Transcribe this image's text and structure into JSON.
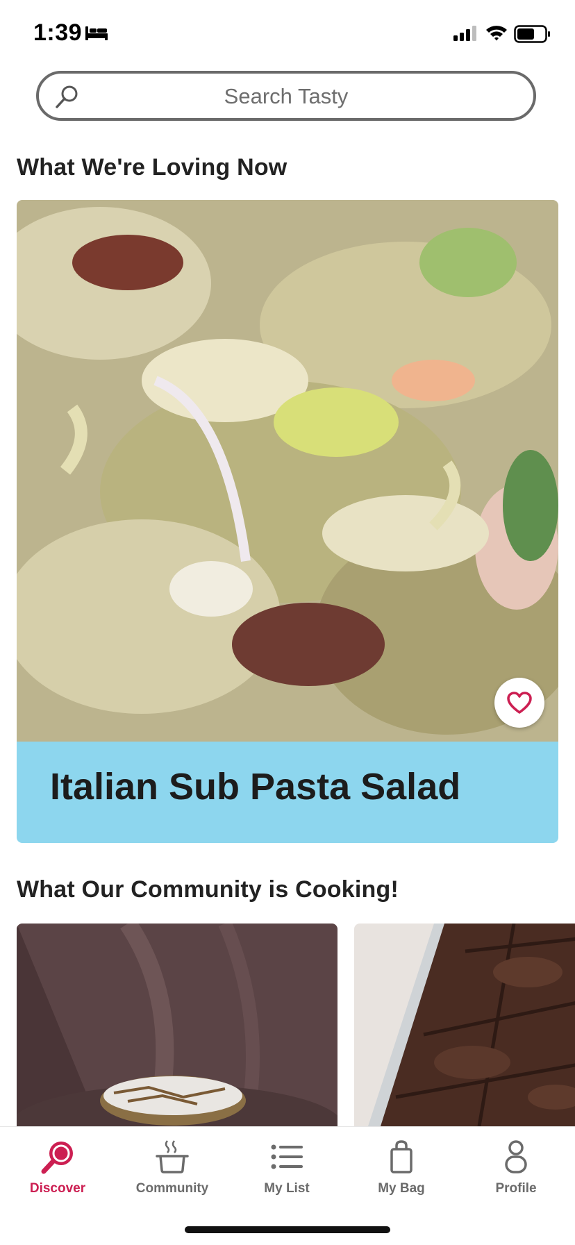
{
  "status_bar": {
    "time": "1:39",
    "icons": [
      "bed-icon",
      "signal-icon",
      "wifi-icon",
      "battery-icon"
    ]
  },
  "search": {
    "placeholder": "Search Tasty",
    "icon": "search-icon"
  },
  "sections": {
    "featured_title": "What We're Loving Now",
    "community_title": "What Our Community is Cooking!"
  },
  "featured": {
    "title": "Italian Sub Pasta Salad",
    "banner_color": "#8dd6ee",
    "favorite_icon": "heart-icon",
    "favorite_color": "#cc1f52"
  },
  "community": {
    "cards": [
      {
        "image": "dessert-on-plate-photo"
      },
      {
        "image": "chocolate-brownies-photo"
      }
    ]
  },
  "tab_bar": {
    "active_color": "#cc1f52",
    "inactive_color": "#6b6b6b",
    "tabs": [
      {
        "label": "Discover",
        "icon": "discover-icon",
        "active": true
      },
      {
        "label": "Community",
        "icon": "cooking-pot-icon",
        "active": false
      },
      {
        "label": "My List",
        "icon": "list-icon",
        "active": false
      },
      {
        "label": "My Bag",
        "icon": "bag-icon",
        "active": false
      },
      {
        "label": "Profile",
        "icon": "profile-icon",
        "active": false
      }
    ]
  }
}
